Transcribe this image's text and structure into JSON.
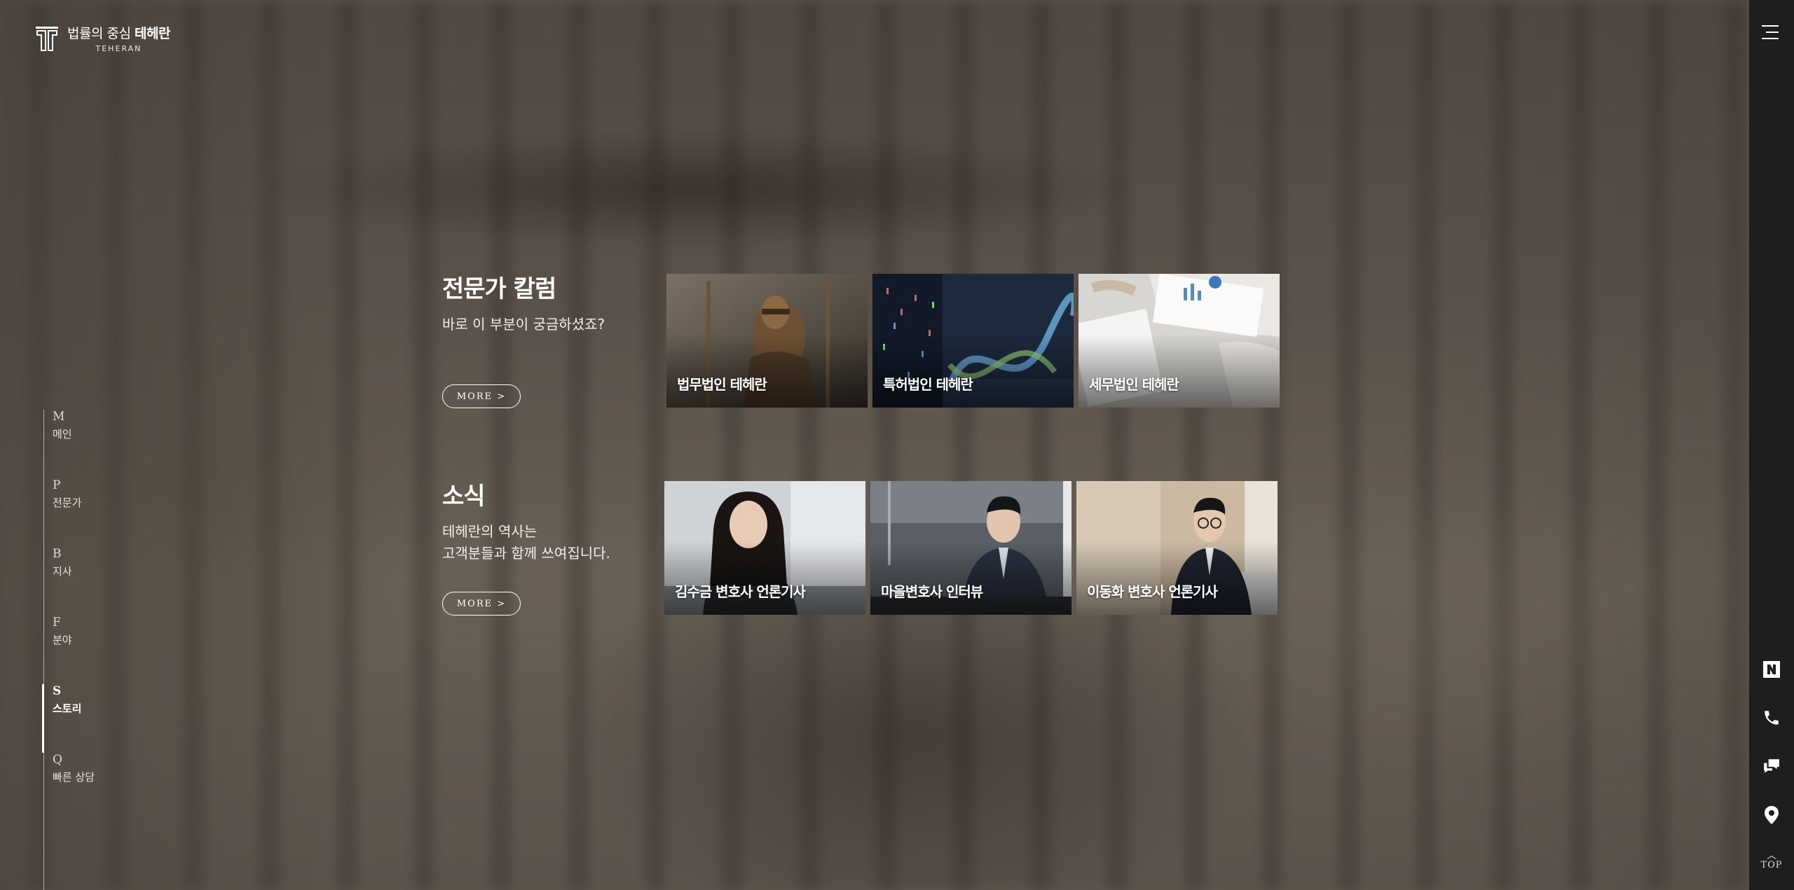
{
  "logo": {
    "ko_prefix": "법률의 중심",
    "ko_brand": "테헤란",
    "en": "TEHERAN"
  },
  "side_nav": [
    {
      "letter": "M",
      "label": "메인"
    },
    {
      "letter": "P",
      "label": "전문가"
    },
    {
      "letter": "B",
      "label": "지사"
    },
    {
      "letter": "F",
      "label": "분야"
    },
    {
      "letter": "S",
      "label": "스토리",
      "active": true
    },
    {
      "letter": "Q",
      "label": "빠른 상담"
    }
  ],
  "column": {
    "title": "전문가 칼럼",
    "subtitle": "바로 이 부분이 궁금하셨죠?",
    "more": "MORE >",
    "cards": [
      {
        "caption": "법무법인 테헤란",
        "image": "justice-statue"
      },
      {
        "caption": "특허법인 테헤란",
        "image": "dna-data"
      },
      {
        "caption": "세무법인 테헤란",
        "image": "report-charts"
      }
    ]
  },
  "news": {
    "title": "소식",
    "subtitle": "테헤란의 역사는\n고객분들과 함께 쓰여집니다.",
    "more": "MORE >",
    "cards": [
      {
        "caption": "김수금 변호사 언론기사",
        "image": "lawyer-woman"
      },
      {
        "caption": "마을변호사 인터뷰",
        "image": "lawyer-man-office"
      },
      {
        "caption": "이동화 변호사 언론기사",
        "image": "lawyer-man-lounge"
      }
    ]
  },
  "rail": {
    "icons": [
      "naver-blog-icon",
      "phone-icon",
      "chat-icon",
      "location-pin-icon"
    ],
    "top": "TOP"
  }
}
